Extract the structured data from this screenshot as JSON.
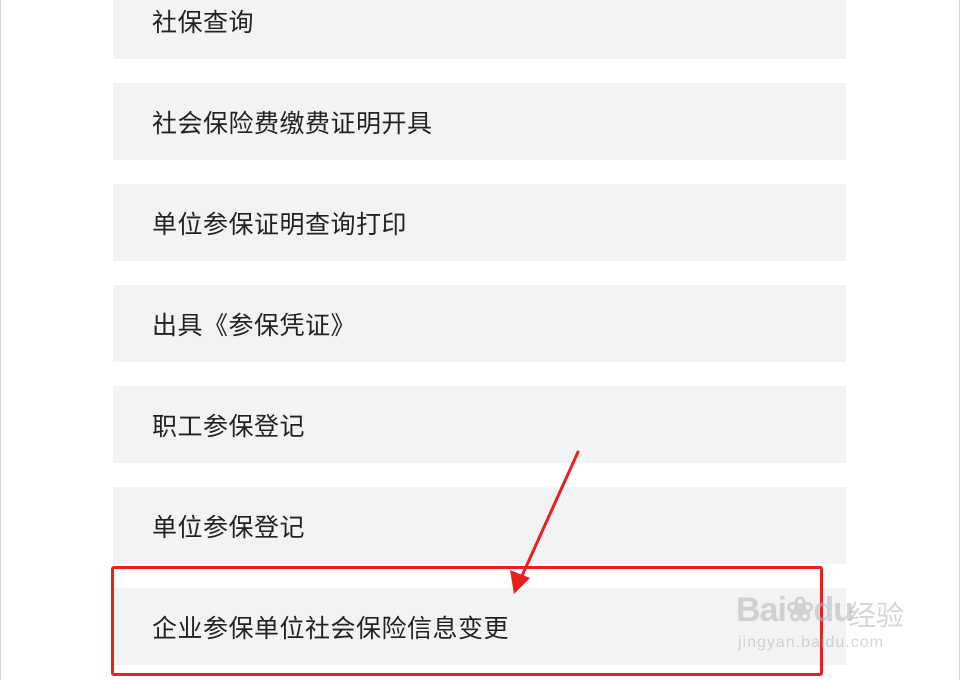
{
  "menu": {
    "items": [
      {
        "label": "社保查询"
      },
      {
        "label": "社会保险费缴费证明开具"
      },
      {
        "label": "单位参保证明查询打印"
      },
      {
        "label": "出具《参保凭证》"
      },
      {
        "label": "职工参保登记"
      },
      {
        "label": "单位参保登记"
      },
      {
        "label": "企业参保单位社会保险信息变更"
      }
    ]
  },
  "annotation": {
    "highlight_color": "#e8201e",
    "highlighted_item": "企业参保单位社会保险信息变更"
  },
  "watermark": {
    "logo_text": "Bai",
    "logo_tail": "du",
    "sub_text": "经验",
    "url_text": "jingyan.baidu.com"
  },
  "colors": {
    "item_background": "#f2f3f5",
    "text": "#222222"
  }
}
